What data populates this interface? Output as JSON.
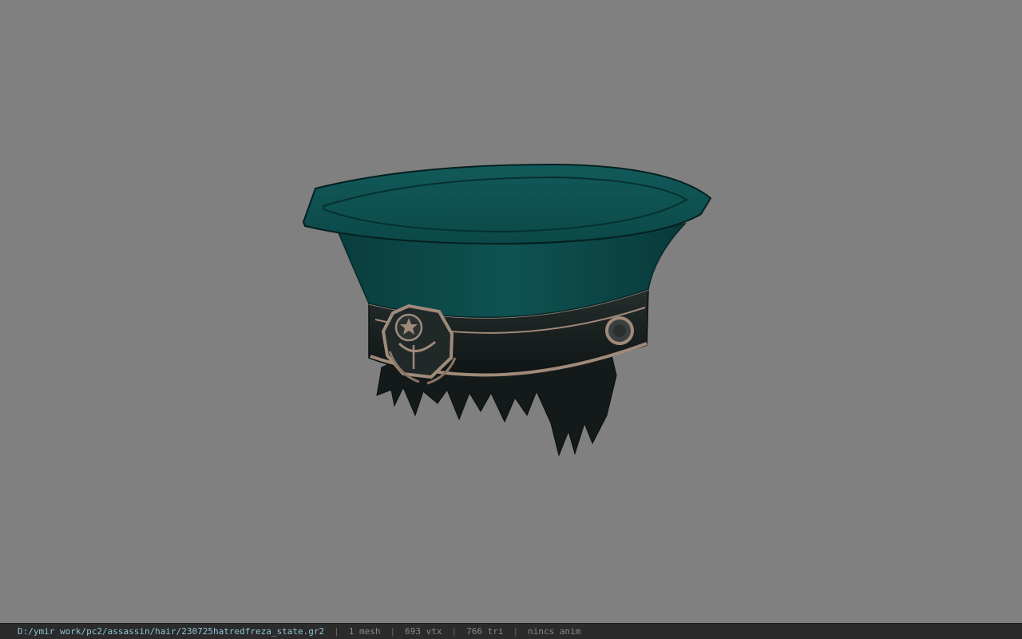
{
  "viewer": {
    "background_color": "#808080",
    "model_icon": "cap-model-icon"
  },
  "status": {
    "file_path": "D:/ymir work/pc2/assassin/hair/230725hatredfreza_state.gr2",
    "separator": "|",
    "mesh_count": "1 mesh",
    "vertex_count": "693 vtx",
    "triangle_count": "766 tri",
    "anim_info": "nincs anim"
  },
  "colors": {
    "cap_teal": "#0c4a4a",
    "band_dark": "#1c2424",
    "trim_tan": "#a08a7a",
    "hair_dark": "#141a1a"
  }
}
